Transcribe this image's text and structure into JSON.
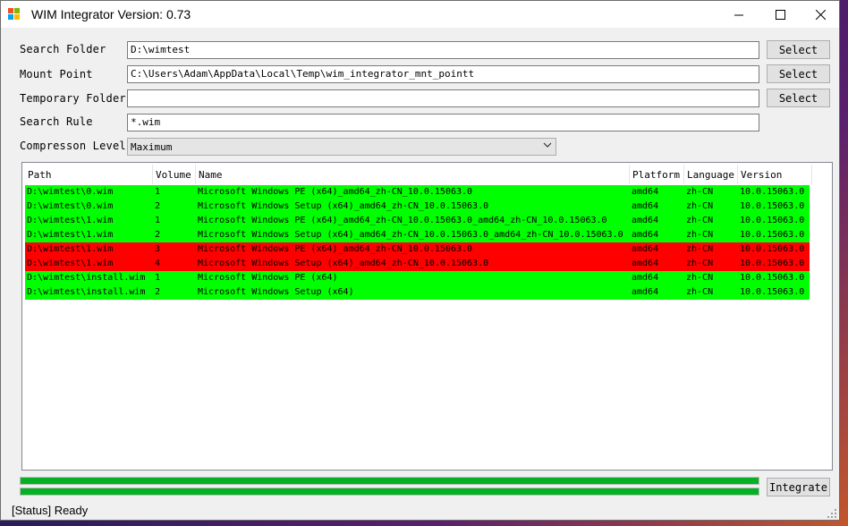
{
  "window": {
    "title": "WIM Integrator Version: 0.73",
    "icon": "app-icon",
    "controls": {
      "minimize": "─",
      "maximize": "☐",
      "close": "✕"
    }
  },
  "form": {
    "search_folder": {
      "label": "Search Folder",
      "value": "D:\\wimtest",
      "button": "Select"
    },
    "mount_point": {
      "label": "Mount Point",
      "value": "C:\\Users\\Adam\\AppData\\Local\\Temp\\wim_integrator_mnt_pointt",
      "button": "Select"
    },
    "temp_folder": {
      "label": "Temporary Folder",
      "value": "",
      "button": "Select"
    },
    "search_rule": {
      "label": "Search Rule",
      "value": "*.wim"
    },
    "compression": {
      "label": "Compresson Level",
      "value": "Maximum"
    }
  },
  "table": {
    "columns": [
      "Path",
      "Volume",
      "Name",
      "Platform",
      "Language",
      "Version"
    ],
    "rows": [
      {
        "status": "ok",
        "cells": [
          "D:\\wimtest\\0.wim",
          "1",
          "Microsoft Windows PE (x64)_amd64_zh-CN_10.0.15063.0",
          "amd64",
          "zh-CN",
          "10.0.15063.0"
        ]
      },
      {
        "status": "ok",
        "cells": [
          "D:\\wimtest\\0.wim",
          "2",
          "Microsoft Windows Setup (x64)_amd64_zh-CN_10.0.15063.0",
          "amd64",
          "zh-CN",
          "10.0.15063.0"
        ]
      },
      {
        "status": "ok",
        "cells": [
          "D:\\wimtest\\1.wim",
          "1",
          "Microsoft Windows PE (x64)_amd64_zh-CN_10.0.15063.0_amd64_zh-CN_10.0.15063.0",
          "amd64",
          "zh-CN",
          "10.0.15063.0"
        ]
      },
      {
        "status": "ok",
        "cells": [
          "D:\\wimtest\\1.wim",
          "2",
          "Microsoft Windows Setup (x64)_amd64_zh-CN_10.0.15063.0_amd64_zh-CN_10.0.15063.0",
          "amd64",
          "zh-CN",
          "10.0.15063.0"
        ]
      },
      {
        "status": "bad",
        "cells": [
          "D:\\wimtest\\1.wim",
          "3",
          "Microsoft Windows PE (x64)_amd64_zh-CN_10.0.15063.0",
          "amd64",
          "zh-CN",
          "10.0.15063.0"
        ]
      },
      {
        "status": "bad",
        "cells": [
          "D:\\wimtest\\1.wim",
          "4",
          "Microsoft Windows Setup (x64)_amd64_zh-CN_10.0.15063.0",
          "amd64",
          "zh-CN",
          "10.0.15063.0"
        ]
      },
      {
        "status": "ok",
        "cells": [
          "D:\\wimtest\\install.wim",
          "1",
          "Microsoft Windows PE (x64)",
          "amd64",
          "zh-CN",
          "10.0.15063.0"
        ]
      },
      {
        "status": "ok",
        "cells": [
          "D:\\wimtest\\install.wim",
          "2",
          "Microsoft Windows Setup (x64)",
          "amd64",
          "zh-CN",
          "10.0.15063.0"
        ]
      }
    ],
    "row_colors": {
      "ok": "#00ff00",
      "bad": "#ff0000"
    }
  },
  "progress": [
    {
      "name": "progress-bar-1",
      "fraction": 1.0
    },
    {
      "name": "progress-bar-2",
      "fraction": 1.0
    }
  ],
  "integrate_button": "Integrate",
  "status": "[Status] Ready",
  "colors": {
    "progress_fill": "#06b025",
    "window_bg": "#f0f0f0"
  }
}
